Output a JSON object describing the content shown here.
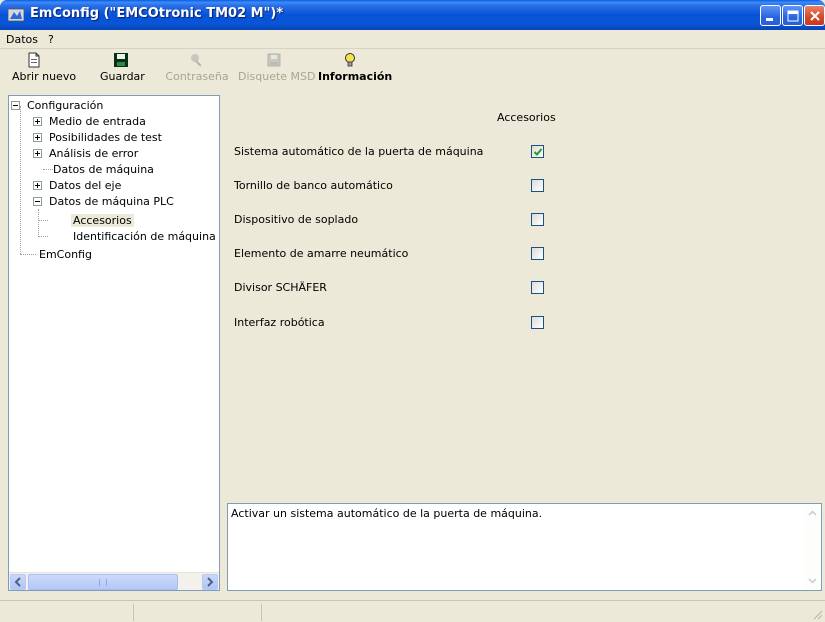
{
  "window": {
    "title": "EmConfig (\"EMCOtronic TM02 M\")*"
  },
  "menu": {
    "items": [
      "Datos",
      "?"
    ]
  },
  "toolbar": {
    "abrir_nuevo": "Abrir nuevo",
    "guardar": "Guardar",
    "contrasena": "Contraseña",
    "disquete": "Disquete MSD",
    "informacion": "Información"
  },
  "tree": {
    "root": "Configuración",
    "medio_entrada": "Medio de entrada",
    "posibilidades_test": "Posibilidades de test",
    "analisis_error": "Análisis de error",
    "datos_maquina": "Datos de máquina",
    "datos_eje": "Datos del eje",
    "datos_maquina_plc": "Datos de máquina PLC",
    "accesorios": "Accesorios",
    "identificacion": "Identificación de máquina A(",
    "emconfig": "EmConfig"
  },
  "panel": {
    "title": "Accesorios",
    "options": [
      {
        "label": "Sistema automático de la puerta de máquina",
        "checked": true
      },
      {
        "label": "Tornillo de banco automático",
        "checked": false
      },
      {
        "label": "Dispositivo de soplado",
        "checked": false
      },
      {
        "label": "Elemento de amarre neumático",
        "checked": false
      },
      {
        "label": "Divisor SCHÄFER",
        "checked": false
      },
      {
        "label": "Interfaz robótica",
        "checked": false
      }
    ]
  },
  "description": {
    "text": "Activar un sistema automático de la puerta de máquina."
  },
  "colors": {
    "titlebar": "#0753d8",
    "face": "#ece9d8",
    "check": "#21a121"
  }
}
